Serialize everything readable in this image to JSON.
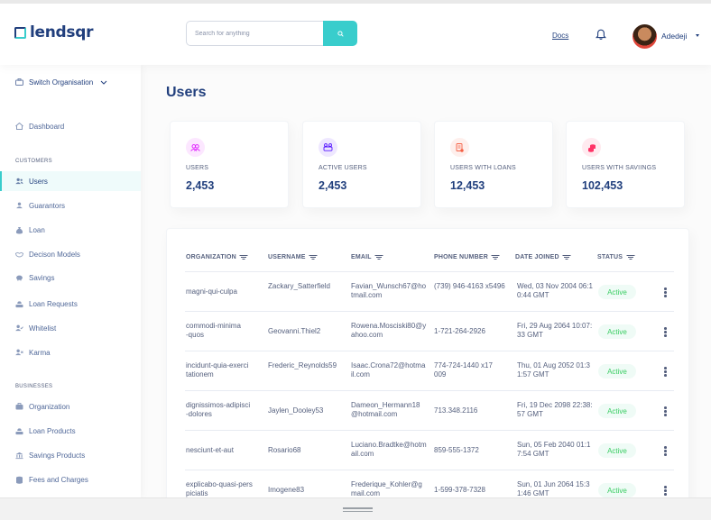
{
  "header": {
    "brand": "lendsqr",
    "search_placeholder": "Search for anything",
    "docs_label": "Docs",
    "user_name": "Adedeji"
  },
  "sidebar": {
    "switch_org": "Switch Organisation",
    "dashboard": "Dashboard",
    "customers_heading": "CUSTOMERS",
    "customers": [
      {
        "label": "Users",
        "icon": "users-icon",
        "active": true
      },
      {
        "label": "Guarantors",
        "icon": "guarantors-icon"
      },
      {
        "label": "Loan",
        "icon": "loan-sack-icon"
      },
      {
        "label": "Decison Models",
        "icon": "handshake-icon"
      },
      {
        "label": "Savings",
        "icon": "piggy-bank-icon"
      },
      {
        "label": "Loan Requests",
        "icon": "loan-request-icon"
      },
      {
        "label": "Whitelist",
        "icon": "user-check-icon"
      },
      {
        "label": "Karma",
        "icon": "user-x-icon"
      }
    ],
    "businesses_heading": "BUSINESSES",
    "businesses": [
      {
        "label": "Organization",
        "icon": "briefcase-icon"
      },
      {
        "label": "Loan Products",
        "icon": "loan-product-icon"
      },
      {
        "label": "Savings Products",
        "icon": "bank-icon"
      },
      {
        "label": "Fees and Charges",
        "icon": "coins-icon"
      }
    ]
  },
  "page": {
    "title": "Users"
  },
  "stats": [
    {
      "label": "USERS",
      "value": "2,453",
      "icon": "users-icon",
      "color": "#df18ff"
    },
    {
      "label": "ACTIVE USERS",
      "value": "2,453",
      "icon": "active-users-icon",
      "color": "#5718ff"
    },
    {
      "label": "USERS WITH LOANS",
      "value": "12,453",
      "icon": "loan-doc-icon",
      "color": "#f55f44"
    },
    {
      "label": "USERS WITH SAVIINGS",
      "value": "102,453",
      "icon": "coins-icon",
      "color": "#ff3366"
    }
  ],
  "table": {
    "columns": [
      "ORGANIZATION",
      "USERNAME",
      "EMAIL",
      "PHONE NUMBER",
      "DATE JOINED",
      "STATUS"
    ],
    "rows": [
      {
        "organization": "magni-qui-culpa",
        "username": "Zackary_Satterfield",
        "email": "Favian_Wunsch67@hotmail.com",
        "phone": "(739) 946-4163 x5496",
        "date": "Wed, 03 Nov 2004 06:10:44 GMT",
        "status": "Active"
      },
      {
        "organization": "commodi-minima-quos",
        "username": "Geovanni.Thiel2",
        "email": "Rowena.Mosciski80@yahoo.com",
        "phone": "1-721-264-2926",
        "date": "Fri, 29 Aug 2064 10:07:33 GMT",
        "status": "Active"
      },
      {
        "organization": "incidunt-quia-exercitationem",
        "username": "Frederic_Reynolds59",
        "email": "Isaac.Crona72@hotmail.com",
        "phone": "774-724-1440 x17009",
        "date": "Thu, 01 Aug 2052 01:31:57 GMT",
        "status": "Active"
      },
      {
        "organization": "dignissimos-adipisci-dolores",
        "username": "Jaylen_Dooley53",
        "email": "Dameon_Hermann18@hotmail.com",
        "phone": "713.348.2116",
        "date": "Fri, 19 Dec 2098 22:38:57 GMT",
        "status": "Active"
      },
      {
        "organization": "nesciunt-et-aut",
        "username": "Rosario68",
        "email": "Luciano.Bradtke@hotmail.com",
        "phone": "859-555-1372",
        "date": "Sun, 05 Feb 2040 01:17:54 GMT",
        "status": "Active"
      },
      {
        "organization": "explicabo-quasi-perspiciatis",
        "username": "Imogene83",
        "email": "Frederique_Kohler@gmail.com",
        "phone": "1-599-378-7328",
        "date": "Sun, 01 Jun 2064 15:31:46 GMT",
        "status": "Active"
      }
    ]
  },
  "colors": {
    "primary": "#213f7d",
    "accent": "#39cdcc",
    "active_status": "#39cd62",
    "muted_text": "#545f7d"
  }
}
